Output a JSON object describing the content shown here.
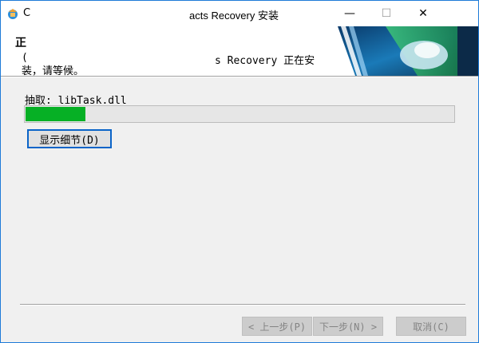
{
  "window": {
    "title": "acts Recovery 安装",
    "title_cut": "C",
    "controls": {
      "minimize": "—",
      "maximize": "☐",
      "close": "✕"
    }
  },
  "header": {
    "title": "正",
    "desc_left": "(",
    "desc_right": "s Recovery 正在安",
    "desc_line2": "装，请等候。"
  },
  "main": {
    "extract_label": "抽取: libTask.dll",
    "progress": 0.14,
    "details_button": "显示细节(D)"
  },
  "footer": {
    "back_button": "< 上一步(P)",
    "next_button": "下一步(N) >",
    "cancel_button": "取消(C)"
  },
  "colors": {
    "progress_fill": "#06b025",
    "window_border": "#1e7bd8",
    "focus_border": "#0a64c8"
  }
}
